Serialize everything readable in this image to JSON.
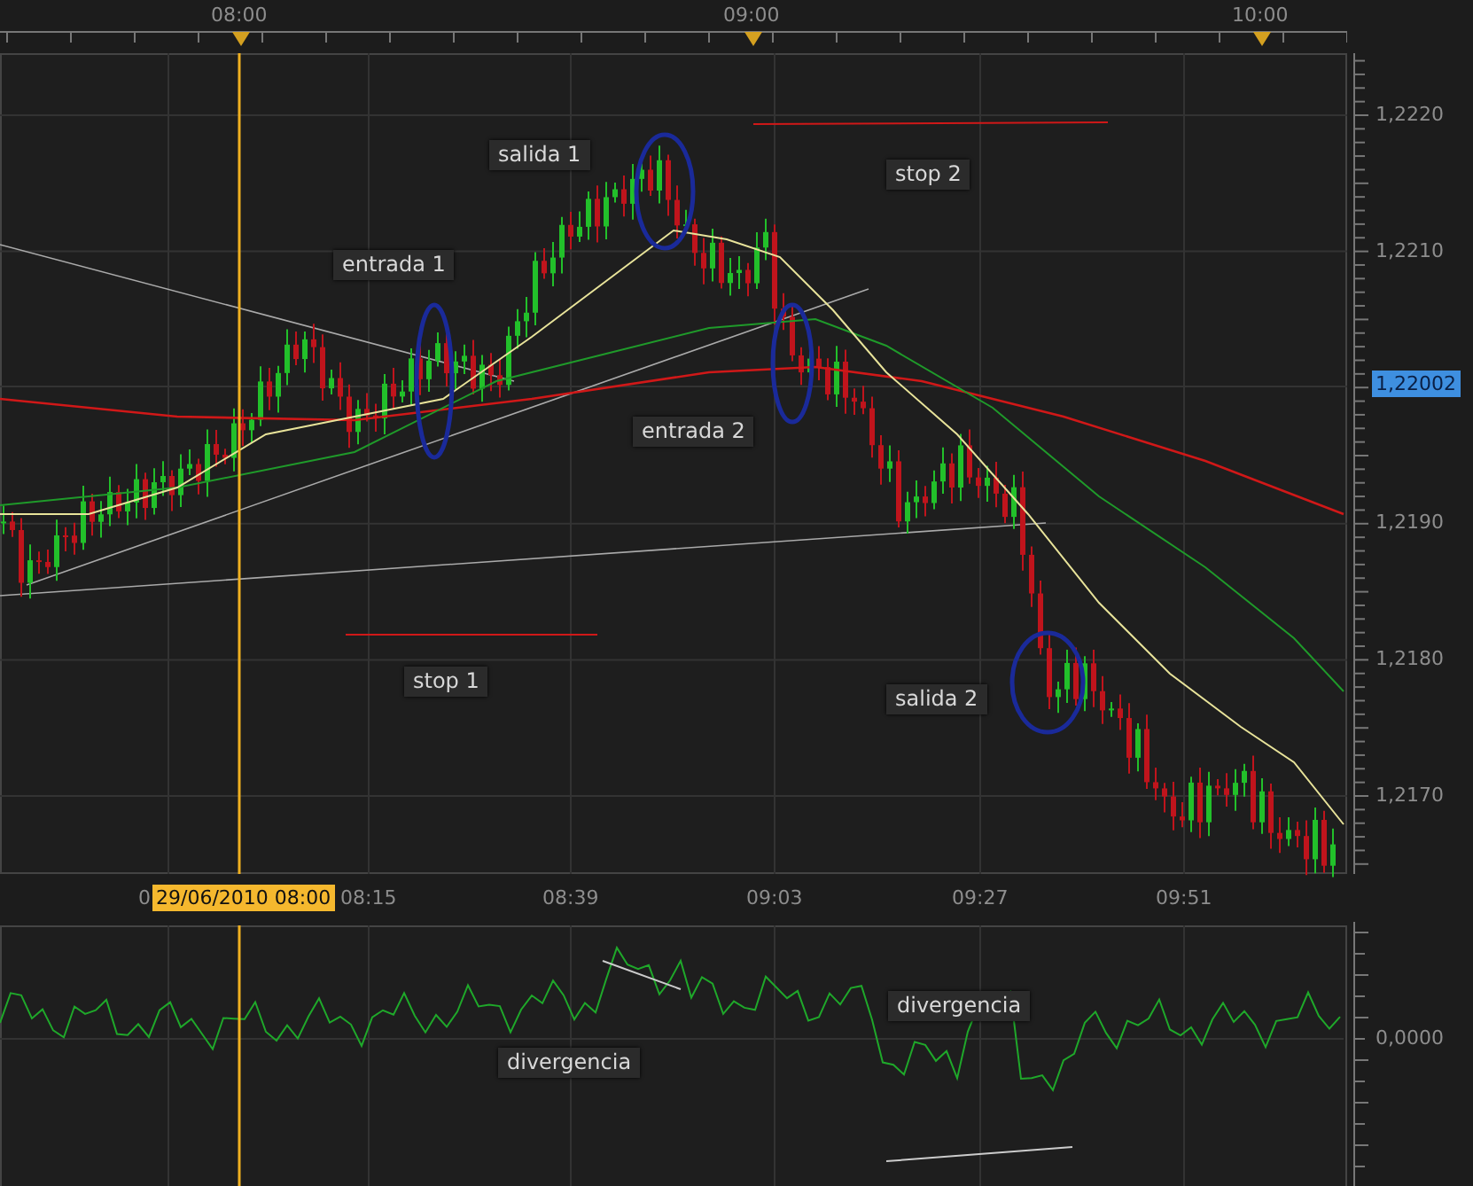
{
  "top_axis": {
    "labels": [
      "08:00",
      "09:00",
      "10:00"
    ]
  },
  "price_axis": {
    "ticks": [
      "1,2220",
      "1,2210",
      "1,2190",
      "1,2180",
      "1,2170"
    ],
    "current_price": "1,22002"
  },
  "annotations": [
    {
      "text": "salida 1"
    },
    {
      "text": "entrada 1"
    },
    {
      "text": "stop 2"
    },
    {
      "text": "entrada 2"
    },
    {
      "text": "stop 1"
    },
    {
      "text": "salida 2"
    }
  ],
  "time_axis": {
    "partial_label": "0",
    "cursor_date": "29/06/2010 08:00",
    "labels": [
      "08:15",
      "08:39",
      "09:03",
      "09:27",
      "09:51"
    ]
  },
  "oscillator": {
    "zero_label": "0,0000",
    "annotations": [
      {
        "text": "divergencia"
      },
      {
        "text": "divergencia"
      }
    ]
  }
}
